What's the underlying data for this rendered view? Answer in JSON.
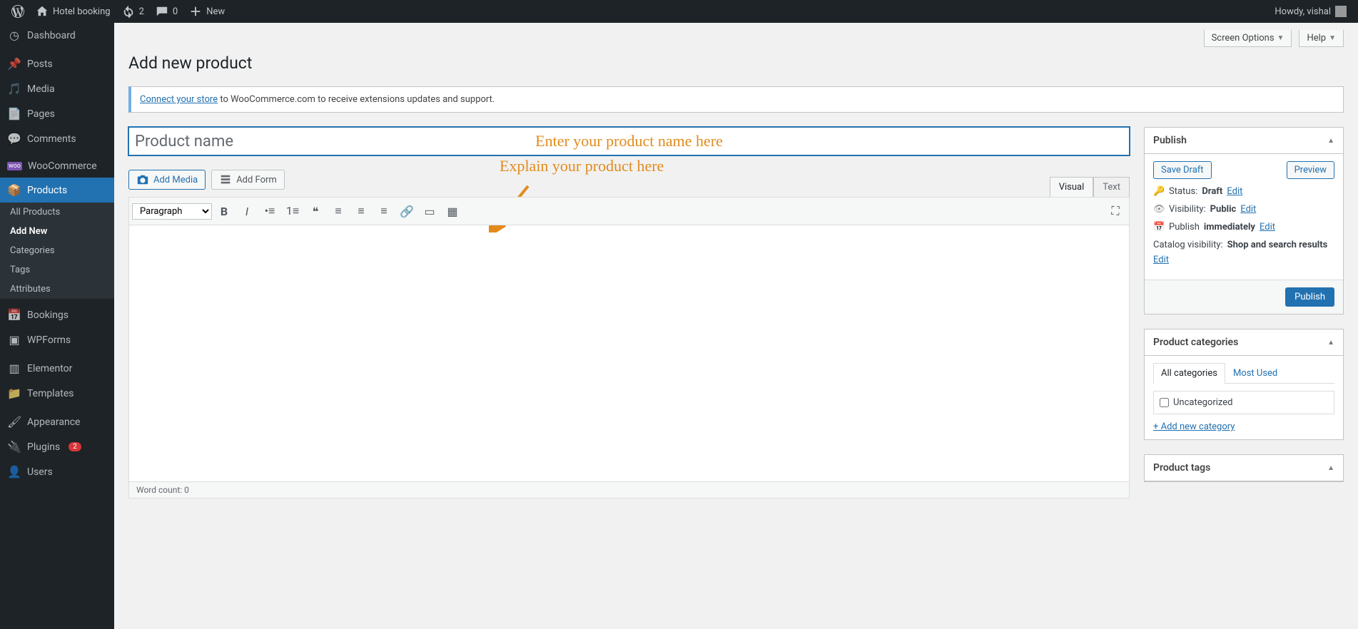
{
  "adminbar": {
    "site_name": "Hotel booking",
    "updates_count": "2",
    "comments_count": "0",
    "new_label": "New",
    "howdy": "Howdy, vishal"
  },
  "menu": {
    "dashboard": "Dashboard",
    "posts": "Posts",
    "media": "Media",
    "pages": "Pages",
    "comments": "Comments",
    "woocommerce": "WooCommerce",
    "products": "Products",
    "products_sub": {
      "all": "All Products",
      "add": "Add New",
      "cats": "Categories",
      "tags": "Tags",
      "attrs": "Attributes"
    },
    "bookings": "Bookings",
    "wpforms": "WPForms",
    "elementor": "Elementor",
    "templates": "Templates",
    "appearance": "Appearance",
    "plugins": "Plugins",
    "plugins_count": "2",
    "users": "Users"
  },
  "topright": {
    "screen_options": "Screen Options",
    "help": "Help"
  },
  "page_title": "Add new product",
  "notice": {
    "link": "Connect your store",
    "text": " to WooCommerce.com to receive extensions updates and support."
  },
  "title_placeholder": "Product name",
  "overlay1": "Enter your product name here",
  "overlay2": "Explain your product here",
  "editor": {
    "add_media": "Add Media",
    "add_form": "Add Form",
    "tab_visual": "Visual",
    "tab_text": "Text",
    "paragraph": "Paragraph",
    "word_count": "Word count: 0"
  },
  "publish": {
    "title": "Publish",
    "save_draft": "Save Draft",
    "preview": "Preview",
    "status_label": "Status:",
    "status_value": "Draft",
    "visibility_label": "Visibility:",
    "visibility_value": "Public",
    "publish_label": "Publish",
    "publish_value": "immediately",
    "catalog_label": "Catalog visibility:",
    "catalog_value": "Shop and search results",
    "edit": "Edit",
    "publish_btn": "Publish"
  },
  "categories": {
    "title": "Product categories",
    "tab_all": "All categories",
    "tab_most": "Most Used",
    "uncategorized": "Uncategorized",
    "add_new": "+ Add new category"
  },
  "tags": {
    "title": "Product tags"
  }
}
